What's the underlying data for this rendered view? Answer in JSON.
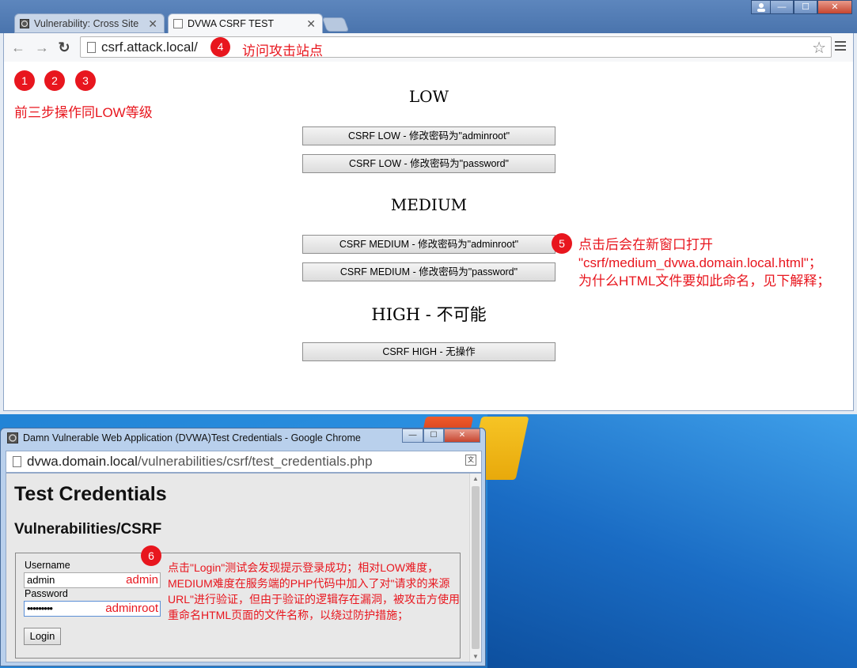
{
  "browser": {
    "tabs": [
      {
        "label": "Vulnerability: Cross Site"
      },
      {
        "label": "DVWA CSRF TEST"
      }
    ],
    "address": "csrf.attack.local/"
  },
  "annotations": {
    "step1": "1",
    "step2": "2",
    "step3": "3",
    "step4": "4",
    "step5": "5",
    "step6": "6",
    "note4": "访问攻击站点",
    "note123": "前三步操作同LOW等级",
    "note5_line1": "点击后会在新窗口打开",
    "note5_line2": "\"csrf/medium_dvwa.domain.local.html\"；",
    "note5_line3": "为什么HTML文件要如此命名，见下解释；",
    "note6": "点击\"Login\"测试会发现提示登录成功；相对LOW难度，MEDIUM难度在服务端的PHP代码中加入了对\"请求的来源URL\"进行验证，但由于验证的逻辑存在漏洞，被攻击方使用重命名HTML页面的文件名称，以绕过防护措施；"
  },
  "page": {
    "low_heading": "LOW",
    "low_btn1": "CSRF LOW - 修改密码为\"adminroot\"",
    "low_btn2": "CSRF LOW - 修改密码为\"password\"",
    "medium_heading": "MEDIUM",
    "medium_btn1": "CSRF MEDIUM - 修改密码为\"adminroot\"",
    "medium_btn2": "CSRF MEDIUM - 修改密码为\"password\"",
    "high_heading": "HIGH - 不可能",
    "high_btn1": "CSRF HIGH - 无操作"
  },
  "popup": {
    "title": "Damn Vulnerable Web Application (DVWA)Test Credentials - Google Chrome",
    "url_domain": "dvwa.domain.local",
    "url_path": "/vulnerabilities/csrf/test_credentials.php",
    "heading": "Test Credentials",
    "subheading": "Vulnerabilities/CSRF",
    "username_label": "Username",
    "username_value": "admin",
    "username_hint": "admin",
    "password_label": "Password",
    "password_value": "•••••••••",
    "password_hint": "adminroot",
    "login_label": "Login"
  },
  "colors": {
    "annotation_red": "#e8161e"
  }
}
